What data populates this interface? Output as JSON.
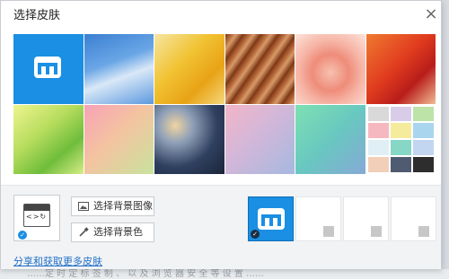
{
  "dialog": {
    "title": "选择皮肤",
    "close_label": "×"
  },
  "skins": [
    {
      "name": "default-max"
    },
    {
      "name": "blue-sky"
    },
    {
      "name": "yellow-leaf"
    },
    {
      "name": "wood-texture"
    },
    {
      "name": "pink-flower"
    },
    {
      "name": "red-leaves"
    },
    {
      "name": "green-leaf"
    },
    {
      "name": "pastel-gradient"
    },
    {
      "name": "night-bokeh"
    },
    {
      "name": "lavender-gradient"
    },
    {
      "name": "mint-gradient"
    },
    {
      "name": "color-palette"
    }
  ],
  "palette_colors": [
    "#d9d9d9",
    "#d9cce8",
    "#bde3a8",
    "#f6b8c0",
    "#f4ec9c",
    "#a9d6ee",
    "#e0eff5",
    "#86d7c6",
    "#c3d6f1",
    "#f2cfb8",
    "#4f5b70",
    "#2d2d2d"
  ],
  "buttons": {
    "choose_image": "选择背景图像",
    "choose_color": "选择背景色"
  },
  "link": "分享和获取更多皮肤",
  "colors": {
    "accent": "#1a8fe3",
    "link": "#1e6fc8"
  },
  "background_page_text": "……定  时  定  标  签  制  、  以  及  浏  览  器  安  全  等  设  置  ……"
}
